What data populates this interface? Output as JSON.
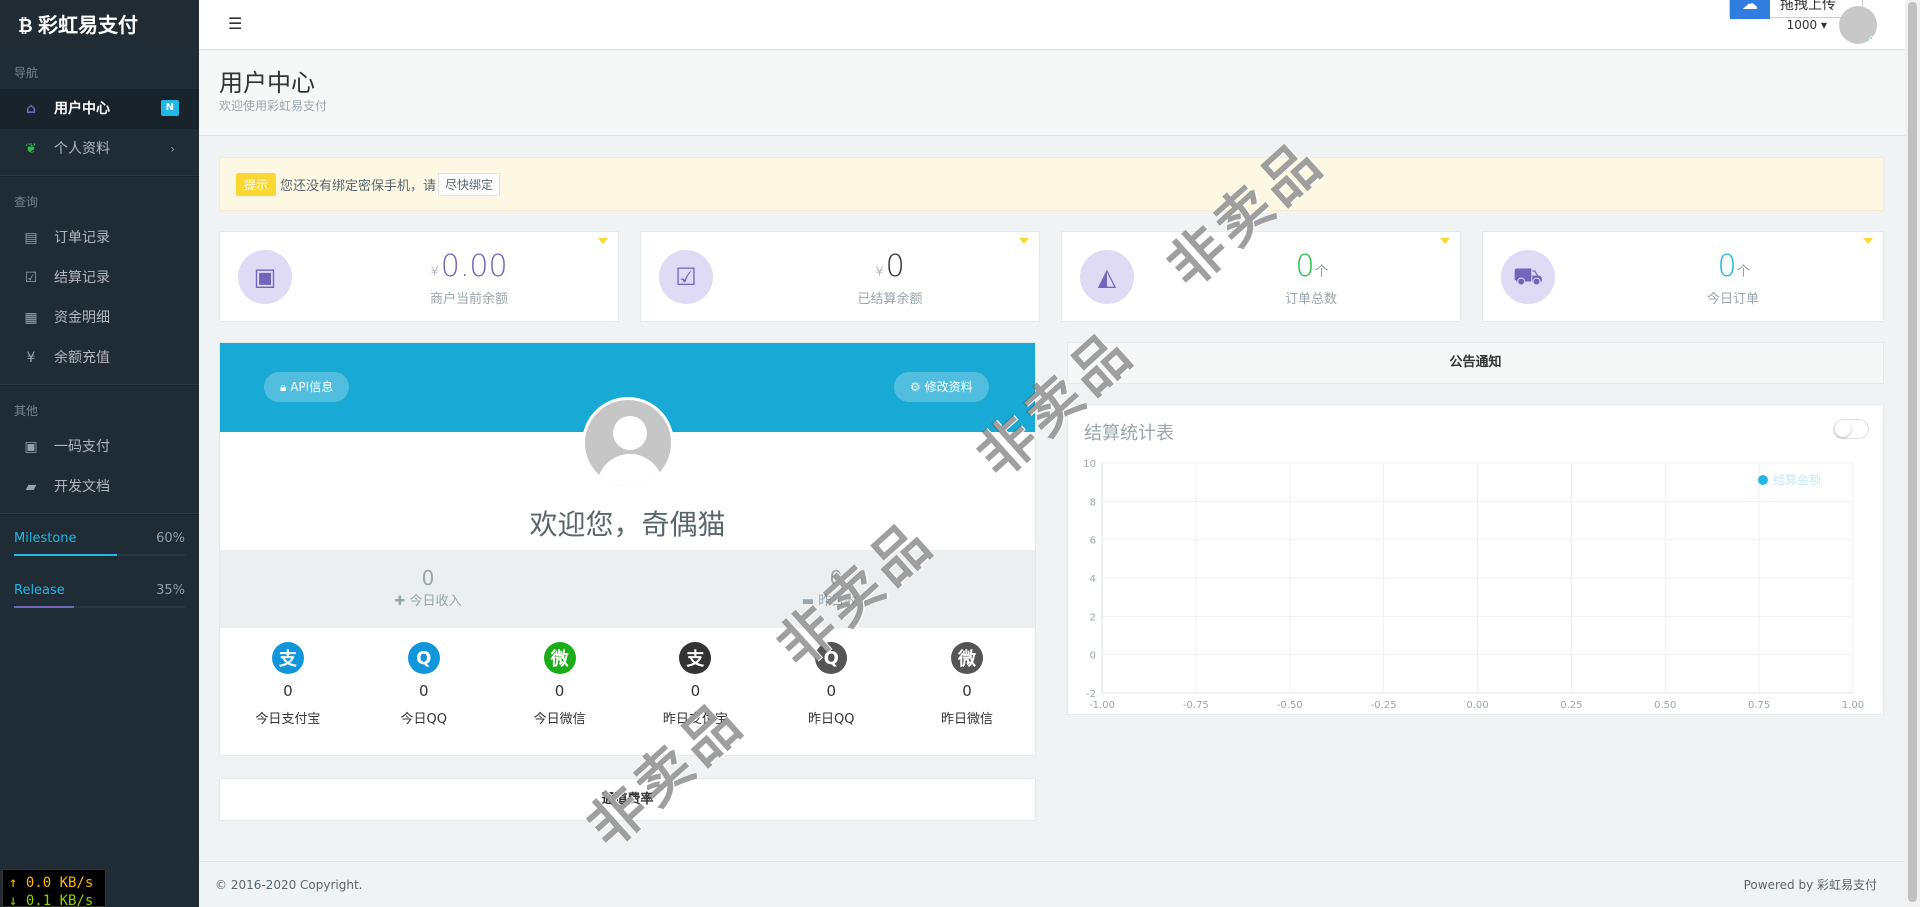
{
  "sidebar": {
    "brand": "彩虹易支付",
    "brand_icon": "bitcoin-icon",
    "sections": [
      {
        "title": "导航"
      },
      {
        "title": "查询"
      },
      {
        "title": "其他"
      }
    ],
    "items": [
      {
        "label": "用户中心",
        "icon": "home-icon",
        "badge": "N"
      },
      {
        "label": "个人资料",
        "icon": "leaf-icon"
      },
      {
        "label": "订单记录",
        "icon": "file-icon"
      },
      {
        "label": "结算记录",
        "icon": "check-square-icon"
      },
      {
        "label": "资金明细",
        "icon": "calendar-icon"
      },
      {
        "label": "余额充值",
        "icon": "yen-icon"
      },
      {
        "label": "一码支付",
        "icon": "qrcode-icon"
      },
      {
        "label": "开发文档",
        "icon": "book-icon"
      }
    ],
    "progress": [
      {
        "label": "Milestone",
        "percent_label": "60%",
        "value": 0.6,
        "color": "#23b7e5"
      },
      {
        "label": "Release",
        "percent_label": "35%",
        "value": 0.35,
        "color": "#7266ba"
      }
    ],
    "netspeed": {
      "up": "↑ 0.0 KB/s",
      "down": "↓ 0.1 KB/s"
    }
  },
  "header": {
    "upload_label": "拖拽上传",
    "user_label": "1000"
  },
  "page": {
    "title": "用户中心",
    "subtitle": "欢迎使用彩虹易支付"
  },
  "alert": {
    "tag": "提示",
    "text": "您还没有绑定密保手机，请",
    "button": "尽快绑定"
  },
  "stats": [
    {
      "unit": "¥",
      "value": "0.00",
      "suffix": "",
      "label": "商户当前余额",
      "color": "#7266ba"
    },
    {
      "unit": "¥",
      "value": "0",
      "suffix": "",
      "label": "已结算余额",
      "color": "#333333"
    },
    {
      "unit": "",
      "value": "0",
      "suffix": "个",
      "label": "订单总数",
      "color": "#27c24c"
    },
    {
      "unit": "",
      "value": "0",
      "suffix": "个",
      "label": "今日订单",
      "color": "#23b7e5"
    }
  ],
  "profile": {
    "api_button": "API信息",
    "edit_button": "修改资料",
    "welcome": "欢迎您，奇偶猫",
    "income": [
      {
        "value": "0",
        "label": "今日收入"
      },
      {
        "value": "0",
        "label": "昨日收入"
      }
    ],
    "channels": [
      {
        "value": "0",
        "label": "今日支付宝",
        "icon": "alipay-icon",
        "color": "#1296db",
        "glyph": "支"
      },
      {
        "value": "0",
        "label": "今日QQ",
        "icon": "qq-icon",
        "color": "#1296db",
        "glyph": "Q"
      },
      {
        "value": "0",
        "label": "今日微信",
        "icon": "wechat-icon",
        "color": "#1aad19",
        "glyph": "微"
      },
      {
        "value": "0",
        "label": "昨日支付宝",
        "icon": "alipay-icon",
        "color": "#333333",
        "glyph": "支"
      },
      {
        "value": "0",
        "label": "昨日QQ",
        "icon": "qq-icon",
        "color": "#555555",
        "glyph": "Q"
      },
      {
        "value": "0",
        "label": "昨日微信",
        "icon": "wechat-icon",
        "color": "#555555",
        "glyph": "微"
      }
    ],
    "bottom_panel": "通道费率"
  },
  "notice": {
    "title": "公告通知"
  },
  "chart_panel": {
    "title": "结算统计表"
  },
  "chart_data": {
    "type": "line",
    "title": "结算统计表",
    "x_ticks": [
      "-1.00",
      "-0.75",
      "-0.50",
      "-0.25",
      "0.00",
      "0.25",
      "0.50",
      "0.75",
      "1.00"
    ],
    "y_ticks": [
      "-2",
      "0",
      "2",
      "4",
      "6",
      "8",
      "10"
    ],
    "xlim": [
      -1,
      1
    ],
    "ylim": [
      -2,
      10
    ],
    "series": [
      {
        "name": "结算金额",
        "values": [],
        "color": "#23b7e5"
      }
    ],
    "legend": "top-right",
    "grid": true
  },
  "footer": {
    "copyright": "© 2016-2020 Copyright.",
    "powered": "Powered by 彩虹易支付"
  },
  "watermark": "非卖品"
}
